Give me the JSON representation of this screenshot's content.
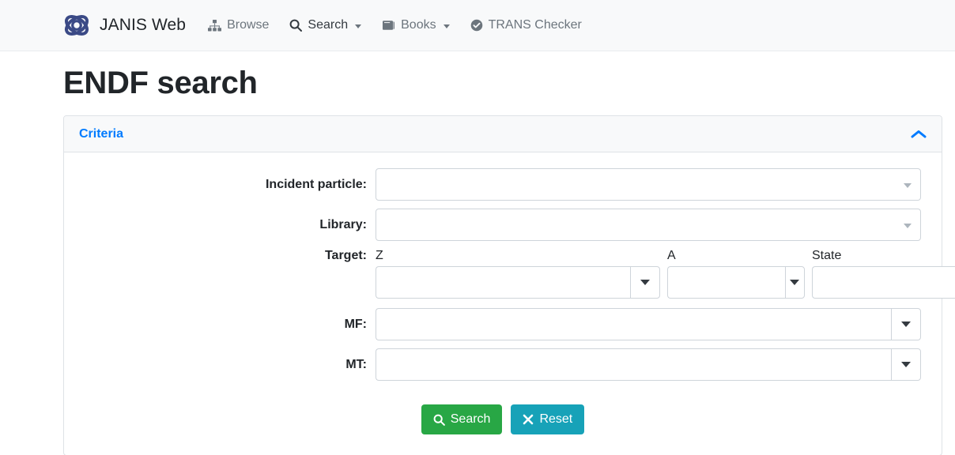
{
  "navbar": {
    "brand": {
      "text": "JANIS Web",
      "logo_icon": "janis-atom-logo"
    },
    "items": [
      {
        "label": "Browse",
        "icon": "sitemap-icon",
        "has_caret": false
      },
      {
        "label": "Search",
        "icon": "search-icon",
        "has_caret": true
      },
      {
        "label": "Books",
        "icon": "book-icon",
        "has_caret": true
      },
      {
        "label": "TRANS Checker",
        "icon": "check-circle-icon",
        "has_caret": false
      }
    ],
    "background_color": "#f8f9fa"
  },
  "page": {
    "title": "ENDF search"
  },
  "card": {
    "header": {
      "title": "Criteria",
      "title_color": "#007bff",
      "toggle_icon": "chevron-up-icon",
      "toggle_icon_color": "#007bff"
    },
    "fields": {
      "incident_particle": {
        "label": "Incident particle:",
        "value": "",
        "placeholder": ""
      },
      "library": {
        "label": "Library:",
        "value": "",
        "placeholder": ""
      },
      "target": {
        "label": "Target:",
        "columns": [
          "Z",
          "A",
          "State"
        ],
        "z": {
          "value": "",
          "placeholder": ""
        },
        "a": {
          "value": "",
          "placeholder": ""
        },
        "state": {
          "value": "",
          "placeholder": ""
        }
      },
      "mf": {
        "label": "MF:",
        "value": "",
        "placeholder": ""
      },
      "mt": {
        "label": "MT:",
        "value": "",
        "placeholder": ""
      }
    },
    "buttons": {
      "search": {
        "label": "Search",
        "icon": "search-icon",
        "color": "#28a745"
      },
      "reset": {
        "label": "Reset",
        "icon": "times-icon",
        "color": "#17a2b8"
      }
    }
  }
}
